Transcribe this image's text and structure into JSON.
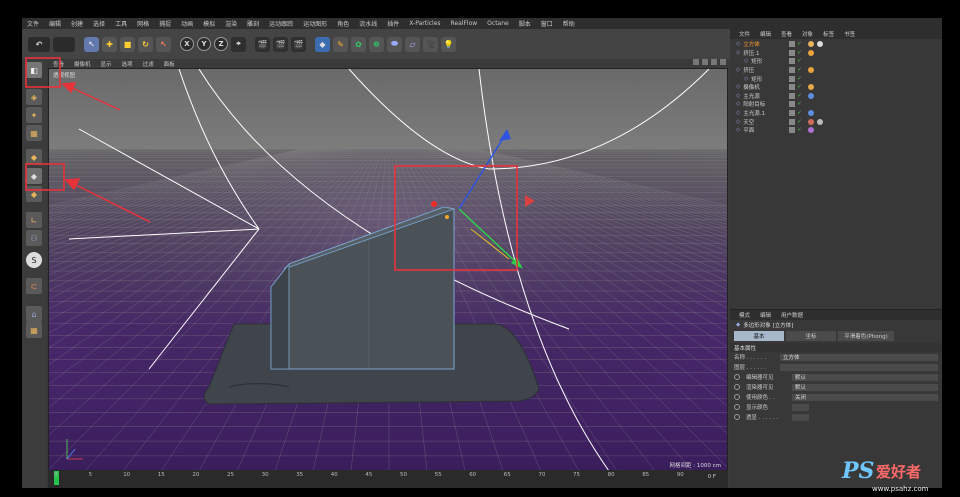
{
  "menu": [
    "文件",
    "编辑",
    "创建",
    "选择",
    "工具",
    "网格",
    "捕捉",
    "动画",
    "模拟",
    "渲染",
    "雕刻",
    "运动跟踪",
    "运动图形",
    "角色",
    "流水线",
    "插件",
    "X-Particles",
    "RealFlow",
    "Octane",
    "脚本",
    "窗口",
    "帮助"
  ],
  "toolbar": {
    "axis_x": "X",
    "axis_y": "Y",
    "axis_z": "Z"
  },
  "viewport": {
    "menu": [
      "查看",
      "摄像机",
      "显示",
      "选项",
      "过滤",
      "面板"
    ],
    "label": "透视视图",
    "grid_distance": "网格间距 : 1000 cm"
  },
  "timeline": {
    "ticks": [
      "0",
      "5",
      "10",
      "15",
      "20",
      "25",
      "30",
      "35",
      "40",
      "45",
      "50",
      "55",
      "60",
      "65",
      "70",
      "75",
      "80",
      "85",
      "90"
    ],
    "frame": "0 F"
  },
  "object_manager": {
    "tabs": [
      "文件",
      "编辑",
      "查看",
      "对象",
      "标签",
      "书签"
    ],
    "objects": [
      {
        "name": "立方体",
        "color": "#ff9d2e"
      },
      {
        "name": "挤压.1",
        "color": "#cfcfcf"
      },
      {
        "name": "矩形",
        "color": "#cfcfcf"
      },
      {
        "name": "挤压",
        "color": "#cfcfcf"
      },
      {
        "name": "矩形",
        "color": "#cfcfcf"
      },
      {
        "name": "摄像机",
        "color": "#cfcfcf"
      },
      {
        "name": "主光源",
        "color": "#cfcfcf"
      },
      {
        "name": "阳射目标",
        "color": "#cfcfcf"
      },
      {
        "name": "主光源.1",
        "color": "#cfcfcf"
      },
      {
        "name": "天空",
        "color": "#cfcfcf"
      },
      {
        "name": "平面",
        "color": "#cfcfcf"
      }
    ]
  },
  "attributes": {
    "tabs": [
      "模式",
      "编辑",
      "用户数据"
    ],
    "title": "多边形对象 [立方体]",
    "modes": [
      "基本",
      "坐标",
      "平滑着色(Phong)"
    ],
    "section": "基本属性",
    "fields": [
      {
        "label": "名称 . . . . . .",
        "value": "立方体"
      },
      {
        "label": "图层 . . . . . .",
        "value": ""
      },
      {
        "label": "编辑器可见",
        "value": "默认"
      },
      {
        "label": "渲染器可见",
        "value": "默认"
      },
      {
        "label": "使用颜色 . .",
        "value": "关闭"
      },
      {
        "label": "显示颜色",
        "value": ""
      },
      {
        "label": "透显 . . . . . .",
        "value": ""
      }
    ]
  },
  "watermark": {
    "brand": "PS",
    "text": "爱好者",
    "site": "www.psahz.com"
  },
  "colors": {
    "highlight_box": "#e8323a",
    "floor": "#4a2a6e",
    "sky": "#6d6d6d"
  }
}
